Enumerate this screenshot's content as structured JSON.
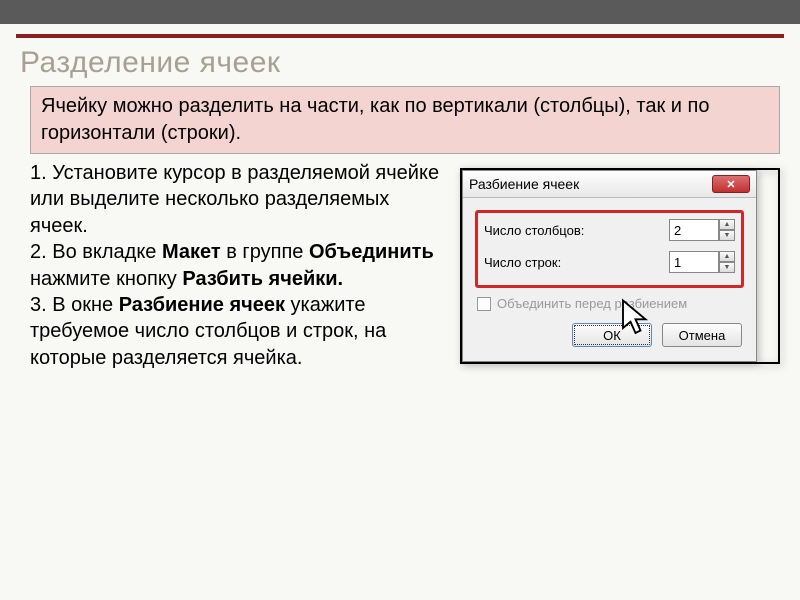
{
  "slide": {
    "title": "Разделение ячеек",
    "intro": "Ячейку можно разделить на части, как по вертикали (столбцы), так и по горизонтали (строки).",
    "step1": "1. Установите курсор в разделяемой ячейке или выделите несколько разделяемых ячеек.",
    "step2_a": "2. Во вкладке ",
    "step2_maket": "Макет",
    "step2_b": " в группе ",
    "step2_obed": "Объединить",
    "step2_c": " нажмите кнопку ",
    "step2_razbit": "Разбить ячейки.",
    "step3_a": "3. В окне ",
    "step3_win": "Разбиение ячеек",
    "step3_b": "  укажите требуемое число столбцов и строк, на которые разделяется ячейка."
  },
  "dialog": {
    "title": "Разбиение ячеек",
    "cols_label": "Число столбцов:",
    "cols_value": "2",
    "rows_label": "Число строк:",
    "rows_value": "1",
    "merge_label": "Объединить перед разбиением",
    "ok": "ОК",
    "cancel": "Отмена"
  }
}
